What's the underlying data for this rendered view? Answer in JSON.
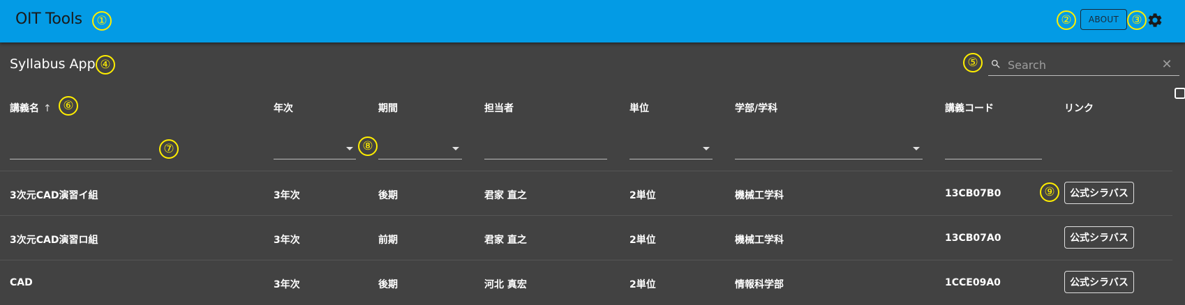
{
  "appbar": {
    "title": "OIT Tools",
    "about_label": "ABOUT",
    "settings_icon": "gear-icon",
    "color": "#039be5"
  },
  "page": {
    "title": "Syllabus App"
  },
  "search": {
    "placeholder": "Search",
    "value": "",
    "icon": "search-icon",
    "clear_icon": "close-icon"
  },
  "table": {
    "headers": [
      {
        "label": "講義名",
        "sort": "ascending"
      },
      {
        "label": "年次"
      },
      {
        "label": "期間"
      },
      {
        "label": "担当者"
      },
      {
        "label": "単位"
      },
      {
        "label": "学部/学科"
      },
      {
        "label": "講義コード"
      },
      {
        "label": "リンク"
      }
    ],
    "sort_icon": "↑",
    "rows": [
      {
        "name": "3次元CAD演習イ組",
        "year": "3年次",
        "term": "後期",
        "teacher": "君家 直之",
        "credits": "2単位",
        "dept": "機械工学科",
        "code": "13CB07B0",
        "link": "公式シラバス"
      },
      {
        "name": "3次元CAD演習ロ組",
        "year": "3年次",
        "term": "前期",
        "teacher": "君家 直之",
        "credits": "2単位",
        "dept": "機械工学科",
        "code": "13CB07A0",
        "link": "公式シラバス"
      },
      {
        "name": "CAD",
        "year": "3年次",
        "term": "後期",
        "teacher": "河北 真宏",
        "credits": "2単位",
        "dept": "情報科学部",
        "code": "1CCE09A0",
        "link": "公式シラバス"
      }
    ]
  },
  "markers": [
    "①",
    "②",
    "③",
    "④",
    "⑤",
    "⑥",
    "⑦",
    "⑧",
    "⑨"
  ]
}
